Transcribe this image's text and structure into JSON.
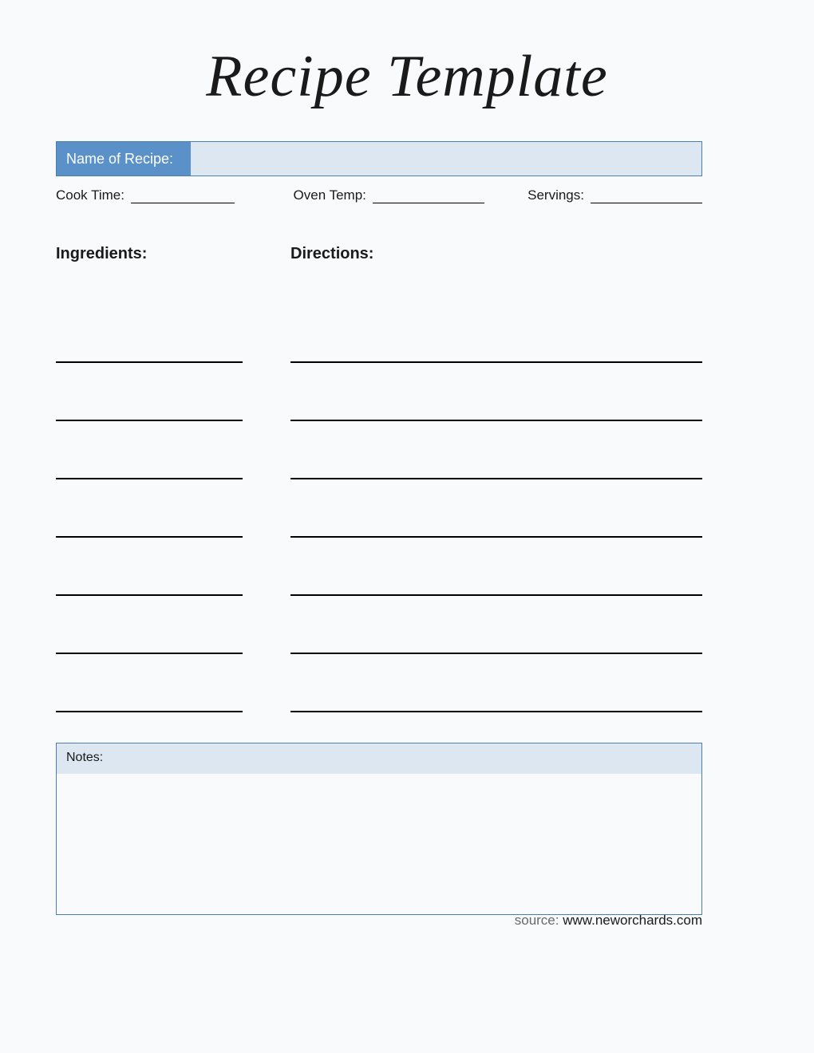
{
  "title": "Recipe Template",
  "name_label": "Name of Recipe:",
  "name_value": "",
  "meta": {
    "cook_time_label": "Cook Time:",
    "cook_time_value": "",
    "oven_temp_label": "Oven Temp:",
    "oven_temp_value": "",
    "servings_label": "Servings:",
    "servings_value": ""
  },
  "ingredients_heading": "Ingredients:",
  "directions_heading": "Directions:",
  "ingredients": [
    "",
    "",
    "",
    "",
    "",
    "",
    ""
  ],
  "directions": [
    "",
    "",
    "",
    "",
    "",
    "",
    ""
  ],
  "notes_label": "Notes:",
  "notes_value": "",
  "source_prefix": "source: ",
  "source_url": "www.neworchards.com"
}
